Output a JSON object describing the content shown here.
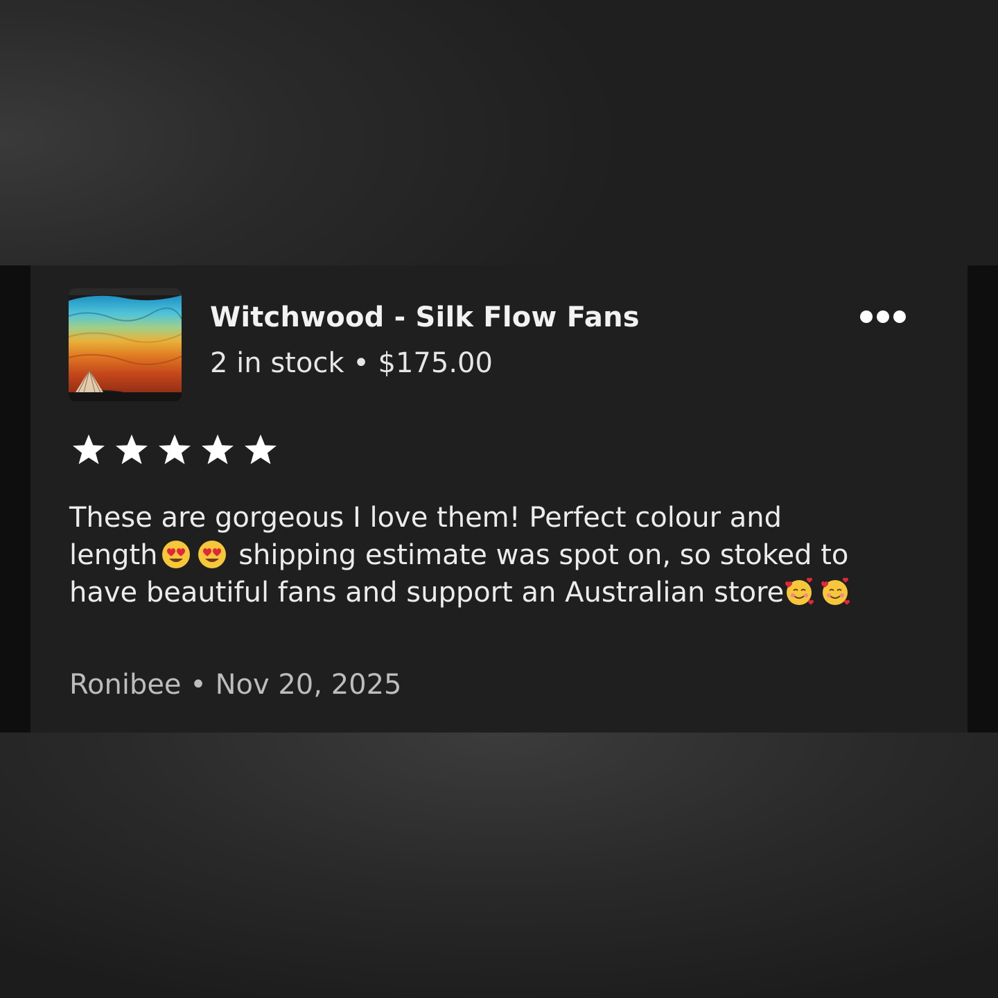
{
  "listing": {
    "title": "Witchwood - Silk Flow Fans",
    "stock": "2 in stock",
    "separator": "•",
    "price": "$175.00",
    "thumbnail_icon": "silk-fan-thumbnail"
  },
  "menu": {
    "icon": "more-options-icon"
  },
  "rating": {
    "stars": 5,
    "max": 5,
    "icon": "star-icon"
  },
  "review": {
    "line1": "These are gorgeous I love them! Perfect colour and",
    "line2_a": "length",
    "line2_b": "shipping estimate was spot on, so stoked to",
    "line3": "have beautiful fans and support an Australian store",
    "emoji_heart_eyes": "heart-eyes-emoji",
    "emoji_smiling_hearts": "smiling-face-with-hearts-emoji"
  },
  "author": {
    "name": "Ronibee",
    "separator": "•",
    "date": "Nov 20, 2025"
  },
  "colors": {
    "card_bg": "#1f1f1f",
    "text_primary": "#f2f2f2",
    "text_muted": "#bdbdbd",
    "star": "#ffffff"
  }
}
